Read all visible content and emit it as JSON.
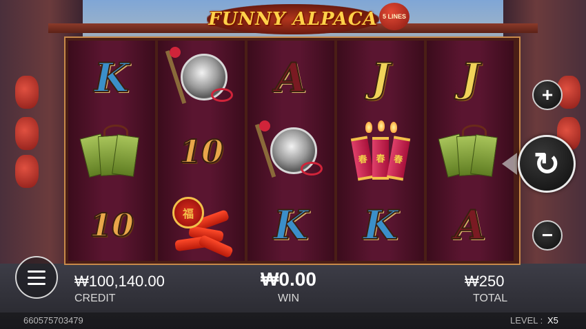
{
  "game": {
    "title": "FUNNY ALPACA",
    "lines_badge": "5 LINES"
  },
  "reels": [
    [
      "K",
      "jade-fan-symbol",
      "10"
    ],
    [
      "gong-symbol",
      "10",
      "red-firecracker-bundle-symbol"
    ],
    [
      "A",
      "gong-symbol",
      "K"
    ],
    [
      "J",
      "firecracker-sticks-symbol",
      "K"
    ],
    [
      "J",
      "jade-fan-symbol",
      "A"
    ]
  ],
  "symbols": {
    "r0c0": "K",
    "r0c2": "10",
    "r1c1": "10",
    "r2c0": "A",
    "r2c2": "K",
    "r3c0": "J",
    "r3c2": "K",
    "r4c0": "J",
    "r4c2": "A",
    "cracker_char": "春",
    "seal_char": "福"
  },
  "controls": {
    "plus_icon": "+",
    "minus_icon": "−",
    "spin_icon": "↻"
  },
  "info": {
    "credit_value": "₩100,140.00",
    "credit_label": "CREDIT",
    "win_value": "₩0.00",
    "win_label": "WIN",
    "total_value": "₩250",
    "total_label": "TOTAL",
    "session_id": "660575703479",
    "level_label": "LEVEL :",
    "level_value": "X5"
  },
  "colors": {
    "win_accent": "#ffffff",
    "title_gold": "#ffd24a"
  }
}
